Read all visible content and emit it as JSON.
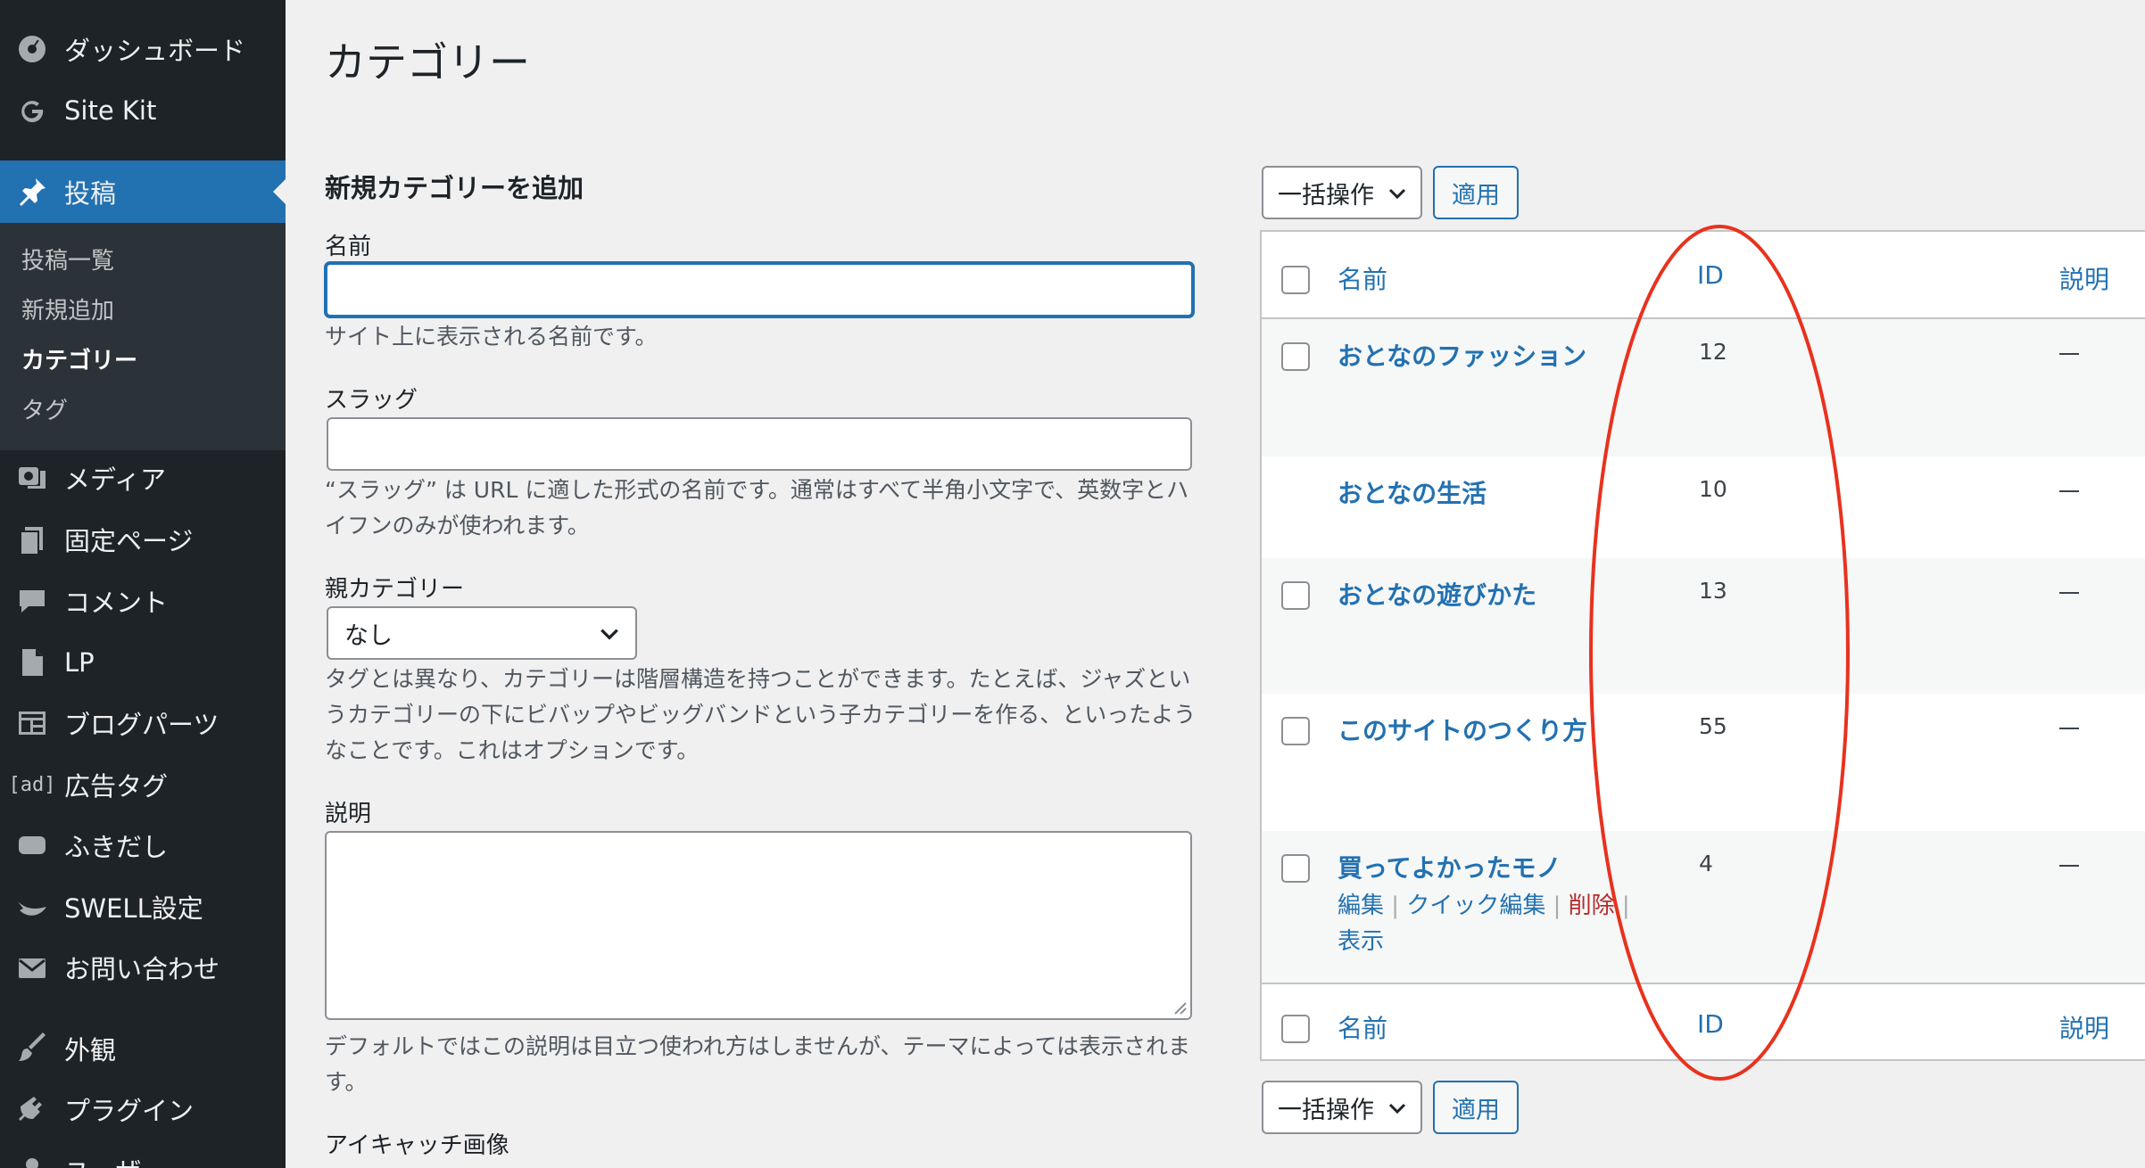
{
  "sidebar": {
    "dashboard": "ダッシュボード",
    "sitekit": "Site Kit",
    "posts": "投稿",
    "sub": {
      "all_posts": "投稿一覧",
      "add_new": "新規追加",
      "categories": "カテゴリー",
      "tags": "タグ"
    },
    "media": "メディア",
    "pages": "固定ページ",
    "comments": "コメント",
    "lp": "LP",
    "blog_parts": "ブログパーツ",
    "ad_icon": "[ad]",
    "ad_tags": "広告タグ",
    "fukidashi": "ふきだし",
    "swell": "SWELL設定",
    "contact": "お問い合わせ",
    "appearance": "外観",
    "plugins": "プラグイン",
    "users": "ユーザー"
  },
  "page": {
    "title": "カテゴリー"
  },
  "form": {
    "heading": "新規カテゴリーを追加",
    "name_label": "名前",
    "name_value": "",
    "name_help": "サイト上に表示される名前です。",
    "slug_label": "スラッグ",
    "slug_value": "",
    "slug_help": "“スラッグ” は URL に適した形式の名前です。通常はすべて半角小文字で、英数字とハイフンのみが使われます。",
    "parent_label": "親カテゴリー",
    "parent_value": "なし",
    "parent_help": "タグとは異なり、カテゴリーは階層構造を持つことができます。たとえば、ジャズというカテゴリーの下にビバップやビッグバンドという子カテゴリーを作る、といったようなことです。これはオプションです。",
    "desc_label": "説明",
    "desc_value": "",
    "desc_help": "デフォルトではこの説明は目立つ使われ方はしませんが、テーマによっては表示されます。",
    "thumb_label": "アイキャッチ画像"
  },
  "bulk": {
    "action_label": "一括操作",
    "apply_label": "適用"
  },
  "table": {
    "headers": {
      "name": "名前",
      "id": "ID",
      "description": "説明"
    },
    "rows": [
      {
        "name": "おとなのファッション",
        "id": "12",
        "description": "—"
      },
      {
        "name": "おとなの生活",
        "id": "10",
        "description": "—"
      },
      {
        "name": "おとなの遊びかた",
        "id": "13",
        "description": "—"
      },
      {
        "name": "このサイトのつくり方",
        "id": "55",
        "description": "—"
      },
      {
        "name": "買ってよかったモノ",
        "id": "4",
        "description": "—"
      }
    ],
    "row_actions": {
      "edit": "編集",
      "quick_edit": "クイック編集",
      "delete": "削除",
      "view": "表示",
      "separator": "|"
    }
  },
  "colors": {
    "accent": "#2271b1",
    "sidebar_bg": "#1d2327",
    "annotation": "#e8321e",
    "delete": "#b32d2e"
  }
}
